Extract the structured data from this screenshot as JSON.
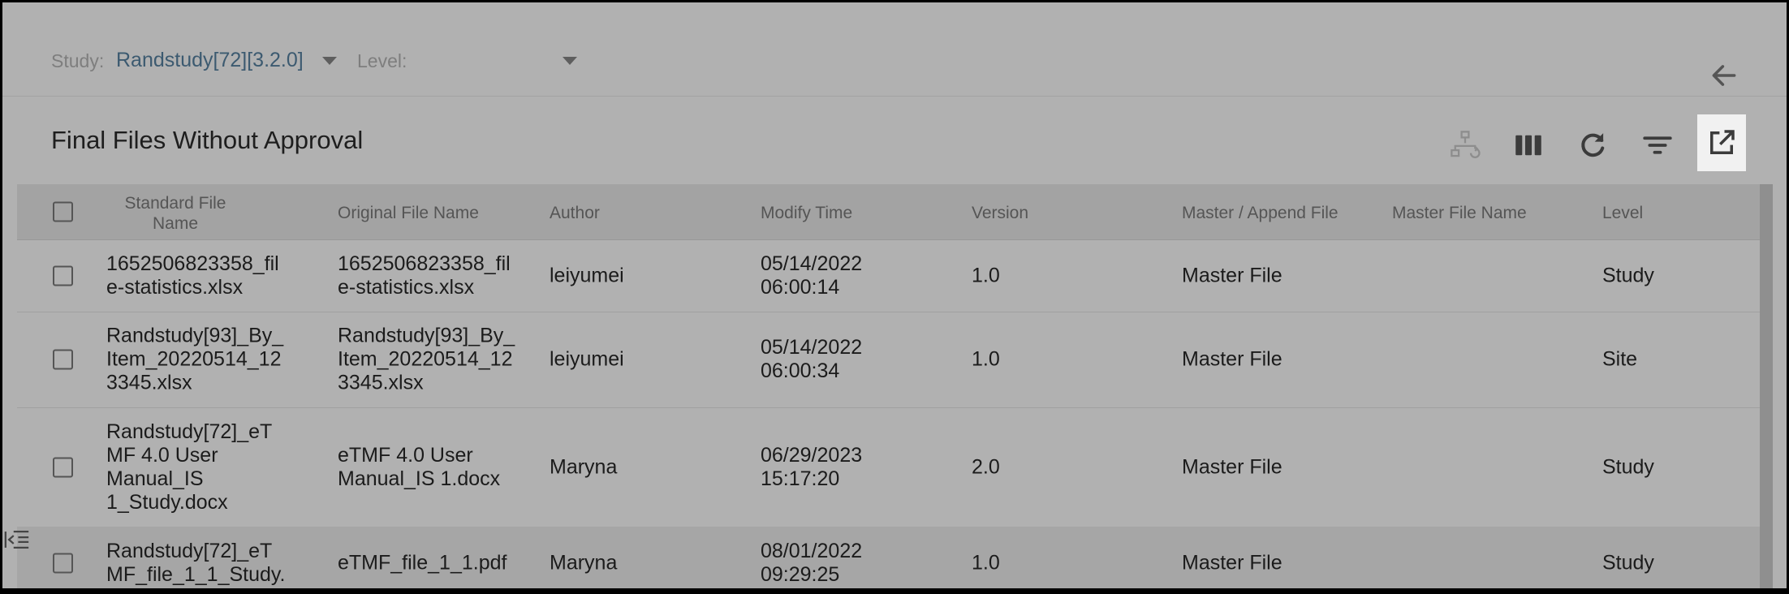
{
  "filters": {
    "study_label": "Study:",
    "study_value": "Randstudy[72][3.2.0]",
    "level_label": "Level:",
    "level_value": ""
  },
  "panel": {
    "title": "Final Files Without Approval"
  },
  "toolbar_icons": [
    "workflow-icon",
    "columns-icon",
    "refresh-icon",
    "filter-icon",
    "export-icon"
  ],
  "table": {
    "columns": {
      "standard_file_name": "Standard File Name",
      "original_file_name": "Original File Name",
      "author": "Author",
      "modify_time": "Modify Time",
      "version": "Version",
      "master_append": "Master / Append File",
      "master_file_name": "Master File Name",
      "level": "Level"
    },
    "rows": [
      {
        "standard": [
          "1652506823358_fil",
          "e-statistics.xlsx"
        ],
        "original": [
          "1652506823358_fil",
          "e-statistics.xlsx"
        ],
        "author": "leiyumei",
        "time": [
          "05/14/2022",
          "06:00:14"
        ],
        "version": "1.0",
        "master_append": "Master File",
        "master_name": "",
        "level": "Study"
      },
      {
        "standard": [
          "Randstudy[93]_By_",
          "Item_20220514_12",
          "3345.xlsx"
        ],
        "original": [
          "Randstudy[93]_By_",
          "Item_20220514_12",
          "3345.xlsx"
        ],
        "author": "leiyumei",
        "time": [
          "05/14/2022",
          "06:00:34"
        ],
        "version": "1.0",
        "master_append": "Master File",
        "master_name": "",
        "level": "Site"
      },
      {
        "standard": [
          "Randstudy[72]_eT",
          "MF 4.0 User",
          "Manual_IS",
          "1_Study.docx"
        ],
        "original": [
          "eTMF 4.0 User",
          "Manual_IS 1.docx"
        ],
        "author": "Maryna",
        "time": [
          "06/29/2023",
          "15:17:20"
        ],
        "version": "2.0",
        "master_append": "Master File",
        "master_name": "",
        "level": "Study"
      },
      {
        "standard": [
          "Randstudy[72]_eT",
          "MF_file_1_1_Study."
        ],
        "original": [
          "eTMF_file_1_1.pdf"
        ],
        "author": "Maryna",
        "time": [
          "08/01/2022",
          "09:29:25"
        ],
        "version": "1.0",
        "master_append": "Master File",
        "master_name": "",
        "level": "Study"
      }
    ]
  }
}
